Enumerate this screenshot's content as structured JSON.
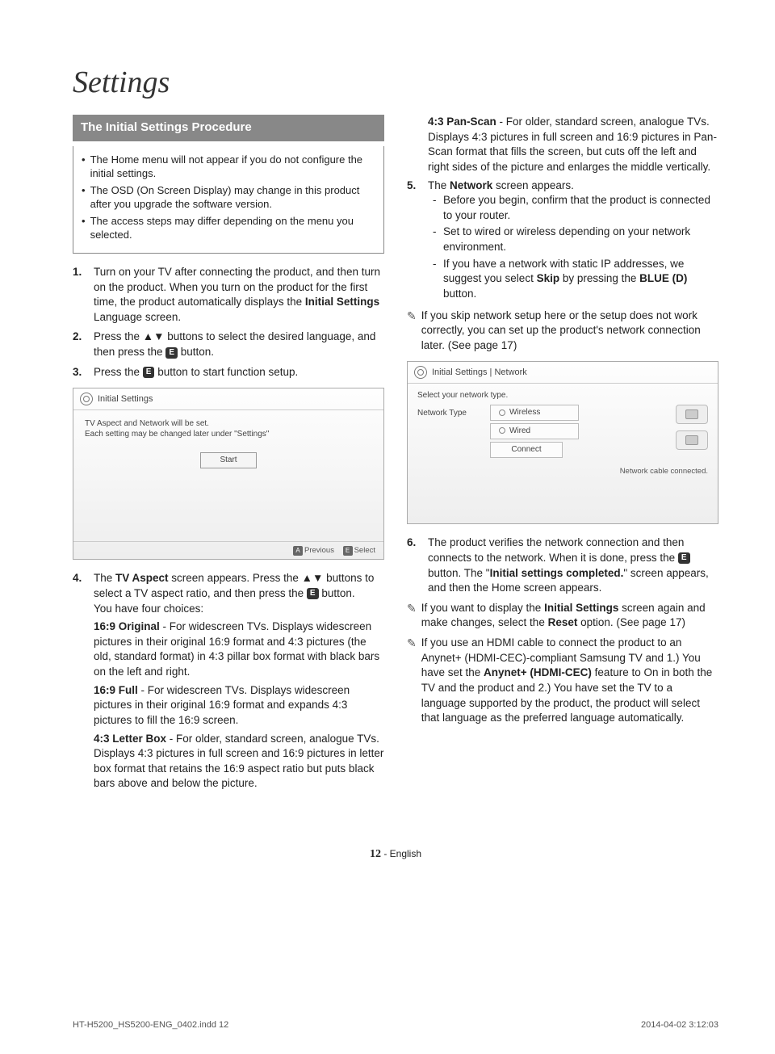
{
  "title": "Settings",
  "section_bar": "The Initial Settings Procedure",
  "info_box": [
    "The Home menu will not appear if you do not configure the initial settings.",
    "The OSD (On Screen Display) may change in this product after you upgrade the software version.",
    "The access steps may differ depending on the menu you selected."
  ],
  "steps_left": {
    "s1": {
      "num": "1.",
      "text_a": "Turn on your TV after connecting the product, and then turn on the product. When you turn on the product for the first time, the product automatically displays the ",
      "bold1": "Initial Settings",
      "text_b": " Language screen."
    },
    "s2": {
      "num": "2.",
      "text_a": "Press the ▲▼ buttons to select the desired language, and then press the ",
      "text_b": " button."
    },
    "s3": {
      "num": "3.",
      "text_a": "Press the ",
      "text_b": " button to start function setup."
    }
  },
  "osd1": {
    "title": "Initial Settings",
    "line1": "TV Aspect and Network will be set.",
    "line2": "Each setting may be changed later under \"Settings\"",
    "start": "Start",
    "prev_key": "A",
    "prev": "Previous",
    "sel_key": "E",
    "sel": "Select"
  },
  "s4": {
    "num": "4.",
    "text_a": "The ",
    "bold1": "TV Aspect",
    "text_b": " screen appears. Press the ▲▼ buttons to select a TV aspect ratio, and then press the ",
    "text_c": " button.",
    "choices_intro": "You have four choices:",
    "c1_b": "16:9 Original",
    "c1": " - For widescreen TVs. Displays widescreen pictures in their original 16:9 format and 4:3 pictures (the old, standard format) in 4:3 pillar box format with black bars on the left and right.",
    "c2_b": "16:9 Full",
    "c2": " - For widescreen TVs. Displays widescreen pictures in their original 16:9 format and expands 4:3 pictures to fill the 16:9 screen.",
    "c3_b": "4:3 Letter Box",
    "c3": " - For older, standard screen, analogue TVs. Displays 4:3 pictures in full screen and 16:9 pictures in letter box format that retains the 16:9 aspect ratio but puts black bars above and below the picture."
  },
  "right_top": {
    "c4_b": "4:3 Pan-Scan",
    "c4": " - For older, standard screen, analogue TVs. Displays 4:3 pictures in full screen and 16:9 pictures in Pan-Scan format that fills the screen, but cuts off the left and right sides of the picture and enlarges the middle vertically."
  },
  "s5": {
    "num": "5.",
    "text_a": "The ",
    "bold1": "Network",
    "text_b": " screen appears.",
    "sub1": "Before you begin, confirm that the product is connected to your router.",
    "sub2": "Set to wired or wireless depending on your network environment.",
    "sub3_a": "If you have a network with static IP addresses, we suggest you select ",
    "sub3_b1": "Skip",
    "sub3_mid": " by pressing the ",
    "sub3_b2": "BLUE (D)",
    "sub3_end": " button."
  },
  "note1": "If you skip network setup here or the setup does not work correctly, you can set up the product's network connection later. (See page 17)",
  "osd2": {
    "title": "Initial Settings | Network",
    "line1": "Select your network type.",
    "type_label": "Network Type",
    "opt1": "Wireless",
    "opt2": "Wired",
    "opt3": "Connect",
    "status": "Network cable connected."
  },
  "s6": {
    "num": "6.",
    "text_a": "The product verifies the network connection and then connects to the network. When it is done, press the ",
    "text_b": " button. The \"",
    "bold1": "Initial settings completed.",
    "text_c": "\" screen appears, and then the Home screen appears."
  },
  "note2_a": "If you want to display the ",
  "note2_b1": "Initial Settings",
  "note2_mid": " screen again and make changes, select the ",
  "note2_b2": "Reset",
  "note2_end": " option. (See page 17)",
  "note3_a": "If you use an HDMI cable to connect the product to an Anynet+ (HDMI-CEC)-compliant Samsung TV and 1.) You have set the ",
  "note3_b1": "Anynet+ (HDMI-CEC)",
  "note3_end": " feature to On in both the TV and the product and 2.) You have set the TV to a language supported by the product, the product will select that language as the preferred language automatically.",
  "footer": {
    "pg": "12",
    "lang": " - English"
  },
  "printfoot": {
    "file": "HT-H5200_HS5200-ENG_0402.indd   12",
    "date": "2014-04-02   3:12:03"
  }
}
